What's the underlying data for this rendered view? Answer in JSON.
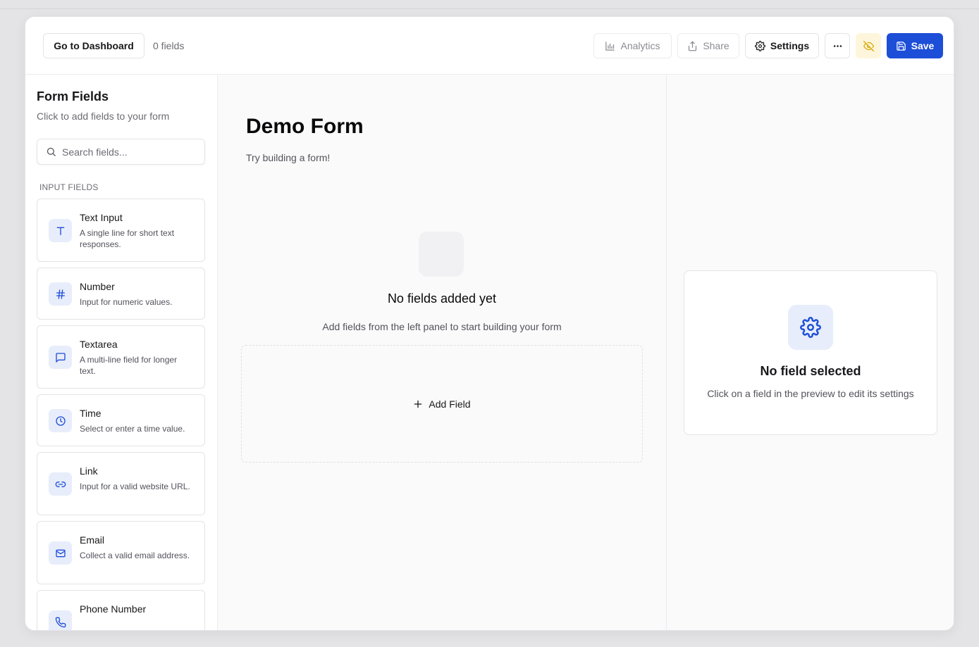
{
  "header": {
    "dashboard_label": "Go to Dashboard",
    "fields_count": "0 fields",
    "analytics_label": "Analytics",
    "share_label": "Share",
    "settings_label": "Settings",
    "save_label": "Save"
  },
  "sidebar": {
    "title": "Form Fields",
    "subtitle": "Click to add fields to your form",
    "search_placeholder": "Search fields...",
    "section_label": "INPUT FIELDS",
    "items": [
      {
        "title": "Text Input",
        "desc": "A single line for short text responses.",
        "icon": "text-icon"
      },
      {
        "title": "Number",
        "desc": "Input for numeric values.",
        "icon": "hash-icon"
      },
      {
        "title": "Textarea",
        "desc": "A multi-line field for longer text.",
        "icon": "message-square-icon"
      },
      {
        "title": "Time",
        "desc": "Select or enter a time value.",
        "icon": "clock-icon"
      },
      {
        "title": "Link",
        "desc": "Input for a valid website URL.",
        "icon": "link-icon"
      },
      {
        "title": "Email",
        "desc": "Collect a valid email address.",
        "icon": "mail-icon"
      },
      {
        "title": "Phone Number",
        "desc": "",
        "icon": "phone-icon"
      }
    ]
  },
  "form": {
    "title": "Demo Form",
    "subtitle": "Try building a form!",
    "empty_title": "No fields added yet",
    "empty_subtitle": "Add fields from the left panel to start building your form",
    "add_field_label": "Add Field"
  },
  "settings_panel": {
    "title": "No field selected",
    "subtitle": "Click on a field in the preview to edit its settings"
  },
  "colors": {
    "accent": "#1d4ed8",
    "icon_bg": "#e8edfb",
    "warning_bg": "#fef6dc"
  }
}
